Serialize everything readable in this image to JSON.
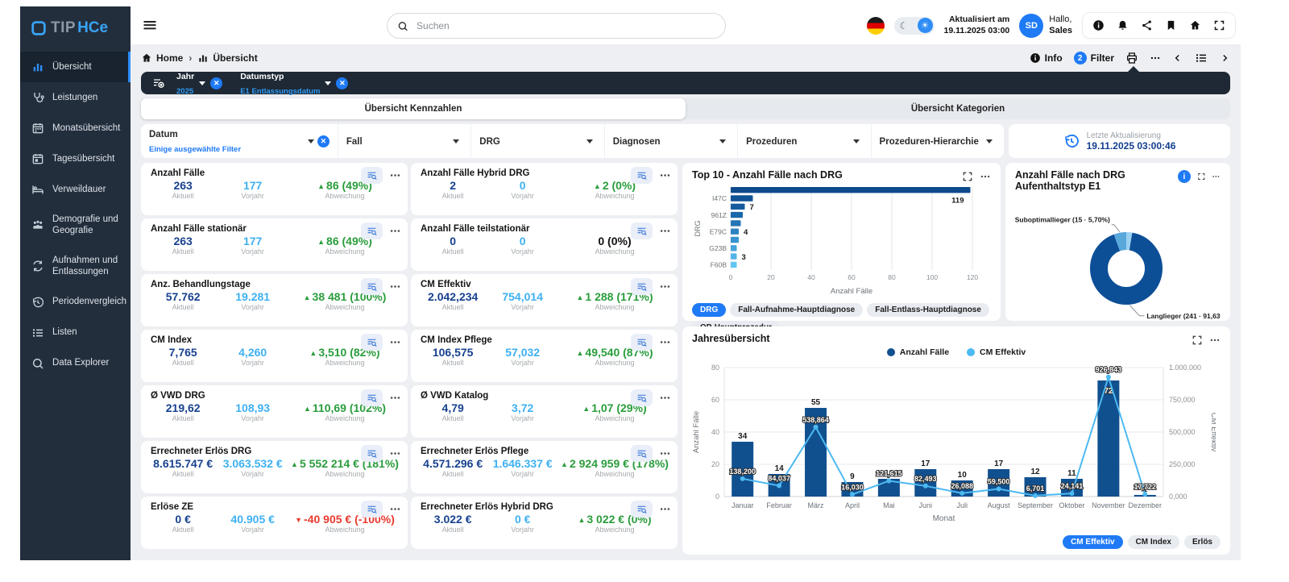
{
  "sidebar": {
    "logo": {
      "tip": "TIP",
      "hce": "HCe"
    },
    "items": [
      {
        "label": "Übersicht",
        "icon": "bar-chart",
        "active": true
      },
      {
        "label": "Leistungen",
        "icon": "stethoscope",
        "active": false
      },
      {
        "label": "Monatsübersicht",
        "icon": "calendar",
        "active": false
      },
      {
        "label": "Tagesübersicht",
        "icon": "calendar-day",
        "active": false
      },
      {
        "label": "Verweildauer",
        "icon": "bed",
        "active": false
      },
      {
        "label": "Demografie und Geografie",
        "icon": "people",
        "active": false
      },
      {
        "label": "Aufnahmen und Entlassungen",
        "icon": "exchange",
        "active": false
      },
      {
        "label": "Periodenvergleich",
        "icon": "history",
        "active": false
      },
      {
        "label": "Listen",
        "icon": "list",
        "active": false
      },
      {
        "label": "Data Explorer",
        "icon": "search",
        "active": false
      }
    ]
  },
  "header": {
    "search_placeholder": "Suchen",
    "updated_label": "Aktualisiert am",
    "updated_value": "19.11.2025 03:00",
    "avatar_initials": "SD",
    "greeting_line1": "Hallo,",
    "greeting_line2": "Sales"
  },
  "breadcrumb": {
    "home": "Home",
    "current": "Übersicht"
  },
  "toolbar": {
    "info_label": "Info",
    "filter_count": "2",
    "filter_label": "Filter"
  },
  "filter_bar": {
    "chips": [
      {
        "label": "Jahr",
        "value": "2025"
      },
      {
        "label": "Datumstyp",
        "value": "E1 Entlassungsdatum"
      }
    ]
  },
  "tabs": [
    {
      "label": "Übersicht Kennzahlen",
      "active": true
    },
    {
      "label": "Übersicht Kategorien",
      "active": false
    }
  ],
  "filters": {
    "dropdowns": [
      {
        "label": "Datum",
        "sub": "Einige ausgewählte Filter",
        "clear": true
      },
      {
        "label": "Fall"
      },
      {
        "label": "DRG"
      },
      {
        "label": "Diagnosen"
      },
      {
        "label": "Prozeduren"
      },
      {
        "label": "Prozeduren-Hierarchie"
      }
    ],
    "last_update_label": "Letzte Aktualisierung",
    "last_update_value": "19.11.2025 03:00:46"
  },
  "kpi_labels": {
    "current": "Aktuell",
    "previous": "Vorjahr",
    "deviation": "Abweichung"
  },
  "kpis": [
    {
      "title": "Anzahl Fälle",
      "current": "263",
      "previous": "177",
      "deviation": "86 (49%)",
      "trend": "up"
    },
    {
      "title": "Anzahl Fälle Hybrid DRG",
      "current": "2",
      "previous": "0",
      "deviation": "2 (0%)",
      "trend": "up"
    },
    {
      "title": "Anzahl Fälle stationär",
      "current": "263",
      "previous": "177",
      "deviation": "86 (49%)",
      "trend": "up"
    },
    {
      "title": "Anzahl Fälle teilstationär",
      "current": "0",
      "previous": "0",
      "deviation": "0 (0%)",
      "trend": "flat"
    },
    {
      "title": "Anz. Behandlungstage",
      "current": "57.762",
      "previous": "19.281",
      "deviation": "38 481 (100%)",
      "trend": "up"
    },
    {
      "title": "CM Effektiv",
      "current": "2.042,234",
      "previous": "754,014",
      "deviation": "1 288 (171%)",
      "trend": "up"
    },
    {
      "title": "CM Index",
      "current": "7,765",
      "previous": "4,260",
      "deviation": "3,510 (82%)",
      "trend": "up"
    },
    {
      "title": "CM Index Pflege",
      "current": "106,575",
      "previous": "57,032",
      "deviation": "49,540 (87%)",
      "trend": "up"
    },
    {
      "title": "Ø VWD DRG",
      "current": "219,62",
      "previous": "108,93",
      "deviation": "110,69 (102%)",
      "trend": "up"
    },
    {
      "title": "Ø VWD Katalog",
      "current": "4,79",
      "previous": "3,72",
      "deviation": "1,07 (29%)",
      "trend": "up"
    },
    {
      "title": "Errechneter Erlös DRG",
      "current": "8.615.747 €",
      "previous": "3.063.532 €",
      "deviation": "5 552 214 € (181%)",
      "trend": "up"
    },
    {
      "title": "Errechneter Erlös Pflege",
      "current": "4.571.296 €",
      "previous": "1.646.337 €",
      "deviation": "2 924 959 € (178%)",
      "trend": "up"
    },
    {
      "title": "Erlöse ZE",
      "current": "0 €",
      "previous": "40.905 €",
      "deviation": "-40 905 € (-100%)",
      "trend": "down"
    },
    {
      "title": "Errechneter Erlös Hybrid DRG",
      "current": "3.022 €",
      "previous": "0 €",
      "deviation": "3 022 € (0%)",
      "trend": "up"
    }
  ],
  "colors": {
    "accent": "#1f7af5",
    "navy": "#17418f",
    "light_blue": "#3eb0f2",
    "green": "#2a9d3c",
    "red": "#e93a2f",
    "bar_dark": "#11508f",
    "line_light": "#4db9f2",
    "donut_dark": "#0d4f97"
  },
  "chart_data": [
    {
      "type": "bar",
      "orientation": "horizontal",
      "title": "Top 10 - Anzahl Fälle nach DRG",
      "xlabel": "Anzahl Fälle",
      "ylabel": "DRG",
      "categories": [
        "",
        "I47C",
        "",
        "961Z",
        "",
        "E79C",
        "",
        "G23B",
        "",
        "F60B"
      ],
      "values": [
        119,
        11,
        7,
        6,
        5,
        4,
        4,
        3,
        3,
        3
      ],
      "value_labels": [
        "119",
        "",
        "7",
        "",
        "",
        "4",
        "",
        "",
        "3",
        ""
      ],
      "xlim": [
        0,
        120
      ],
      "xticks": [
        "0",
        "20",
        "40",
        "60",
        "80",
        "100",
        "120"
      ],
      "bar_colors": [
        "#0d4a8c",
        "#0f5295",
        "#145c9f",
        "#1a67aa",
        "#2274b5",
        "#2c83c2",
        "#3793cf",
        "#44a4db",
        "#52b5e8",
        "#63c6f2"
      ],
      "buttons": [
        {
          "label": "DRG",
          "active": true
        },
        {
          "label": "Fall-Aufnahme-Hauptdiagnose",
          "active": false
        },
        {
          "label": "Fall-Entlass-Hauptdiagnose",
          "active": false
        },
        {
          "label": "OP-Hauptprozedur",
          "active": false
        }
      ]
    },
    {
      "type": "pie",
      "title": "Anzahl Fälle nach DRG Aufenthaltstyp E1",
      "slices": [
        {
          "label": "",
          "value": 2.67,
          "color": "#9bd1f2"
        },
        {
          "label": "Langlieger (241 · 91,63%)",
          "value": 91.63,
          "color": "#0d4f97"
        },
        {
          "label": "Suboptimallieger (15 · 5,70%)",
          "value": 5.7,
          "color": "#58a8dc"
        }
      ]
    },
    {
      "type": "bar+line",
      "title": "Jahresübersicht",
      "xlabel": "Monat",
      "categories": [
        "Januar",
        "Februar",
        "März",
        "April",
        "Mai",
        "Juni",
        "Juli",
        "August",
        "September",
        "Oktober",
        "November",
        "Dezember"
      ],
      "series": [
        {
          "name": "Anzahl Fälle",
          "chart": "bar",
          "axis": "left",
          "color": "#11508f",
          "values": [
            34,
            14,
            55,
            9,
            11,
            17,
            10,
            17,
            12,
            11,
            72,
            1
          ]
        },
        {
          "name": "CM Effektiv",
          "chart": "line",
          "axis": "right",
          "color": "#4db9f2",
          "values": [
            138200,
            84037,
            538864,
            16030,
            121615,
            82493,
            26088,
            59500,
            6701,
            24141,
            926843,
            17722
          ],
          "value_labels": [
            "138,200",
            "84,037",
            "538,864",
            "16,030",
            "121,615",
            "82,493",
            "26,088",
            "59,500",
            "6,701",
            "24,141",
            "926,843",
            "17,722"
          ]
        }
      ],
      "left_axis": {
        "label": "Anzahl Fälle",
        "ticks": [
          "0",
          "20",
          "40",
          "60",
          "80"
        ],
        "max": 80
      },
      "right_axis": {
        "label": "CM Effektiv",
        "ticks": [
          "0,000",
          "250,000",
          "500,000",
          "750,000",
          "1.000.000"
        ],
        "max": 1000000
      },
      "buttons": [
        {
          "label": "CM Effektiv",
          "active": true
        },
        {
          "label": "CM Index",
          "active": false
        },
        {
          "label": "Erlös",
          "active": false
        }
      ]
    }
  ]
}
